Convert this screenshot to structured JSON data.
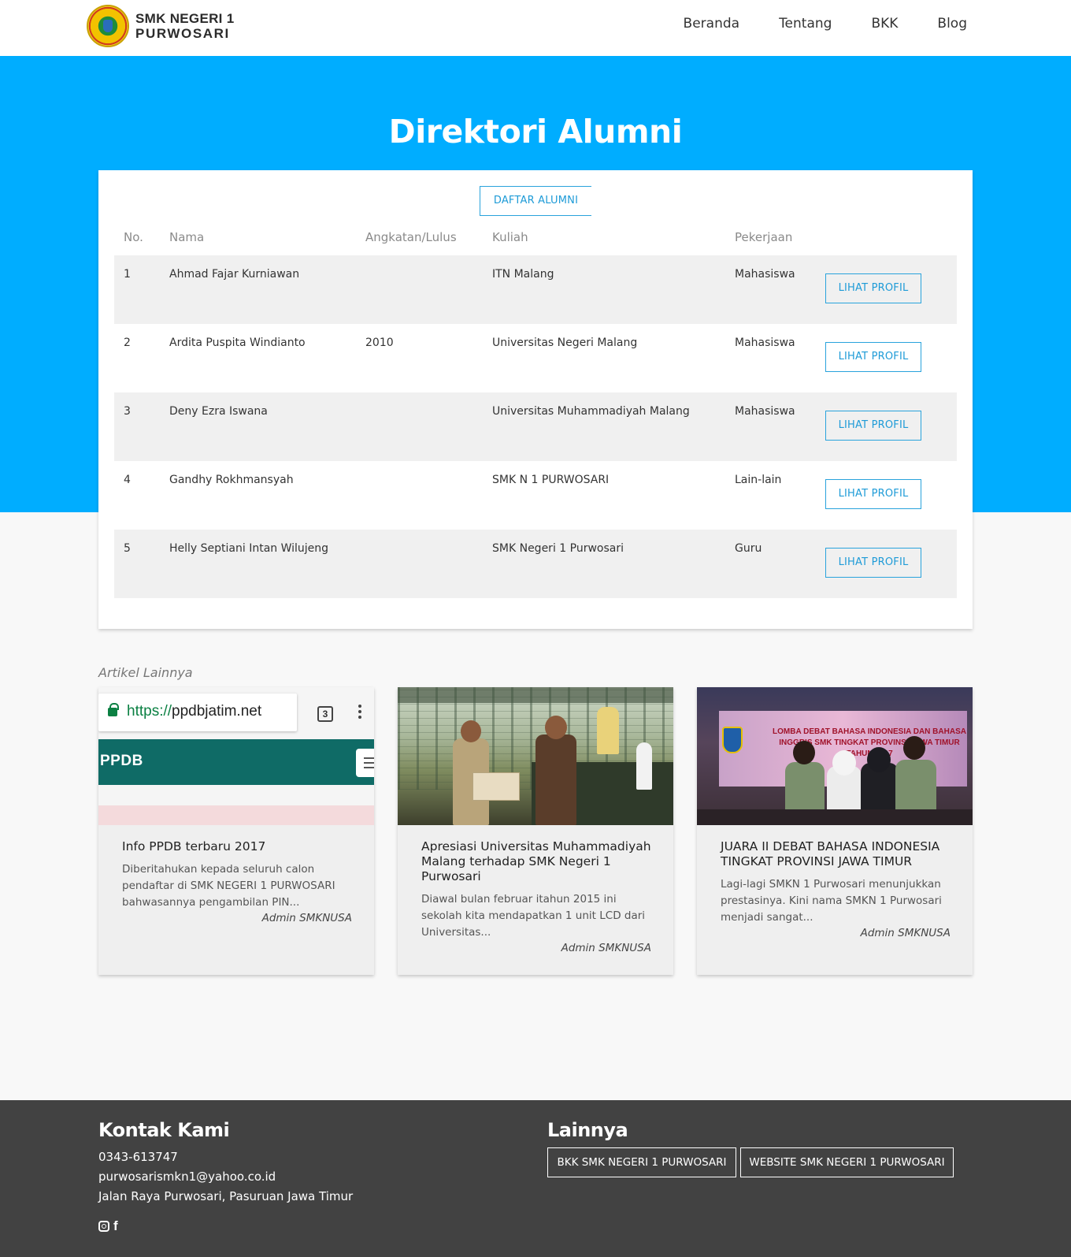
{
  "header": {
    "brand_line1": "SMK NEGERI 1",
    "brand_line2": "PURWOSARI",
    "nav": [
      "Beranda",
      "Tentang",
      "BKK",
      "Blog"
    ]
  },
  "hero": {
    "title": "Direktori Alumni"
  },
  "directory": {
    "tab_label": "DAFTAR ALUMNI",
    "columns": [
      "No.",
      "Nama",
      "Angkatan/Lulus",
      "Kuliah",
      "Pekerjaan"
    ],
    "action_label": "LIHAT PROFIL",
    "rows": [
      {
        "no": "1",
        "nama": "Ahmad Fajar Kurniawan",
        "angkatan": "",
        "kuliah": "ITN Malang",
        "pekerjaan": "Mahasiswa"
      },
      {
        "no": "2",
        "nama": "Ardita Puspita Windianto",
        "angkatan": "2010",
        "kuliah": "Universitas Negeri Malang",
        "pekerjaan": "Mahasiswa"
      },
      {
        "no": "3",
        "nama": "Deny Ezra Iswana",
        "angkatan": "",
        "kuliah": "Universitas Muhammadiyah Malang",
        "pekerjaan": "Mahasiswa"
      },
      {
        "no": "4",
        "nama": "Gandhy Rokhmansyah",
        "angkatan": "",
        "kuliah": "SMK N 1 PURWOSARI",
        "pekerjaan": "Lain-lain"
      },
      {
        "no": "5",
        "nama": "Helly Septiani Intan Wilujeng",
        "angkatan": "",
        "kuliah": "SMK Negeri 1 Purwosari",
        "pekerjaan": "Guru"
      }
    ]
  },
  "articles": {
    "label": "Artikel Lainnya",
    "items": [
      {
        "title": "Info PPDB terbaru 2017",
        "excerpt": "Diberitahukan kepada seluruh calon pendaftar di SMK NEGERI 1 PURWOSARI bahwasannya pengambilan PIN...",
        "author": "Admin SMKNUSA",
        "image": {
          "url_scheme": "https://",
          "url_host": "ppdbjatim.net",
          "tab_count": "3",
          "site_label": "PPDB"
        }
      },
      {
        "title": "Apresiasi Universitas Muhammadiyah Malang terhadap SMK Negeri 1 Purwosari",
        "excerpt": "Diawal bulan februar itahun 2015  ini sekolah kita mendapatkan 1 unit LCD dari Universitas...",
        "author": "Admin SMKNUSA"
      },
      {
        "title": "JUARA II DEBAT BAHASA INDONESIA TINGKAT PROVINSI JAWA TIMUR",
        "excerpt": "Lagi-lagi SMKN 1 Purwosari menunjukkan prestasinya. Kini nama SMKN 1 Purwosari menjadi sangat...",
        "author": "Admin SMKNUSA",
        "image": {
          "banner_text": "LOMBA DEBAT BAHASA INDONESIA DAN BAHASA INGGRIS SMK TINGKAT PROVINSI JAWA TIMUR TAHUN 2017"
        }
      }
    ]
  },
  "footer": {
    "contact_title": "Kontak Kami",
    "phone": "0343-613747",
    "email": "purwosarismkn1@yahoo.co.id",
    "address": "Jalan Raya Purwosari, Pasuruan Jawa Timur",
    "other_title": "Lainnya",
    "links": [
      "BKK SMK NEGERI 1 PURWOSARI",
      "WEBSITE SMK NEGERI 1 PURWOSARI"
    ],
    "social_icons": [
      "instagram-icon",
      "facebook-icon"
    ]
  },
  "colors": {
    "hero_blue": "#00adff",
    "accent": "#1e9bd7",
    "footer_bg": "#424242"
  }
}
